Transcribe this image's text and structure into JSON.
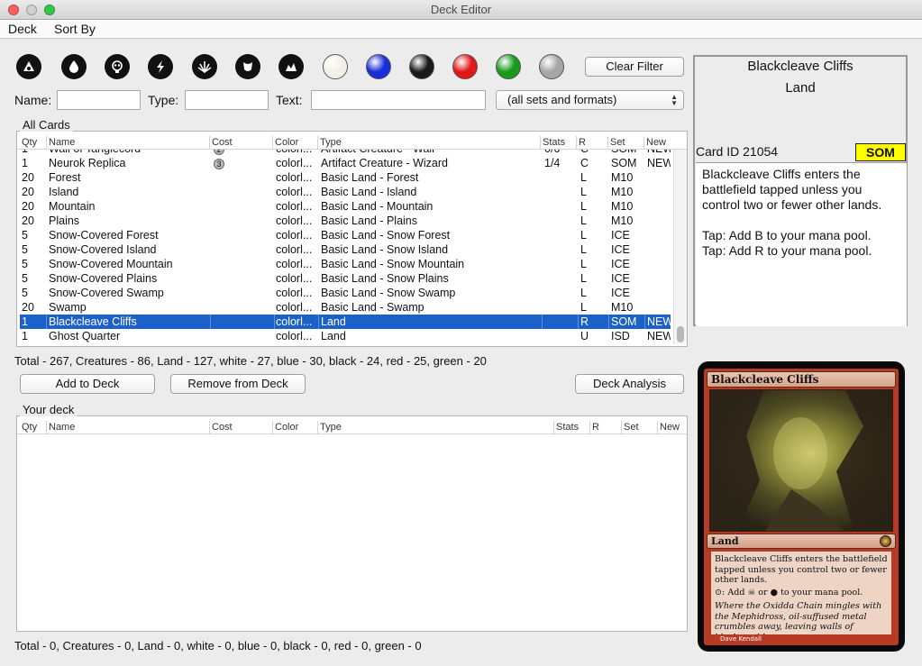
{
  "window": {
    "title": "Deck Editor"
  },
  "menu": {
    "deck": "Deck",
    "sort_by": "Sort By"
  },
  "filters": {
    "mana_symbols": [
      "artifact-icon",
      "blue-mana-icon",
      "black-mana-icon",
      "red-mana-icon",
      "white-mana-icon",
      "green-mana-icon",
      "land-icon"
    ],
    "color_orbs": [
      {
        "name": "white",
        "color": "#f2f0e4"
      },
      {
        "name": "blue",
        "color": "#1a2ed8"
      },
      {
        "name": "black",
        "color": "#1a1a1a"
      },
      {
        "name": "red",
        "color": "#e01818"
      },
      {
        "name": "green",
        "color": "#1a9a1a"
      },
      {
        "name": "colorless",
        "color": "#a6a6a6"
      }
    ],
    "clear_filter": "Clear Filter",
    "name_label": "Name:",
    "name_value": "",
    "type_label": "Type:",
    "type_value": "",
    "text_label": "Text:",
    "text_value": "",
    "set_select": "(all sets and formats)"
  },
  "all_cards": {
    "title": "All Cards",
    "columns": [
      "Qty",
      "Name",
      "Cost",
      "Color",
      "Type",
      "Stats",
      "R",
      "Set",
      "New"
    ],
    "rows": [
      {
        "qty": "1",
        "name": "Wall of Tanglecord",
        "cost": "2",
        "color": "colorl...",
        "type": "Artifact Creature - Wall",
        "stats": "0/6",
        "r": "C",
        "set": "SOM",
        "new": "NEW"
      },
      {
        "qty": "1",
        "name": "Neurok Replica",
        "cost": "3",
        "color": "colorl...",
        "type": "Artifact Creature - Wizard",
        "stats": "1/4",
        "r": "C",
        "set": "SOM",
        "new": "NEW"
      },
      {
        "qty": "20",
        "name": "Forest",
        "cost": "",
        "color": "colorl...",
        "type": "Basic Land - Forest",
        "stats": "",
        "r": "L",
        "set": "M10",
        "new": ""
      },
      {
        "qty": "20",
        "name": "Island",
        "cost": "",
        "color": "colorl...",
        "type": "Basic Land - Island",
        "stats": "",
        "r": "L",
        "set": "M10",
        "new": ""
      },
      {
        "qty": "20",
        "name": "Mountain",
        "cost": "",
        "color": "colorl...",
        "type": "Basic Land - Mountain",
        "stats": "",
        "r": "L",
        "set": "M10",
        "new": ""
      },
      {
        "qty": "20",
        "name": "Plains",
        "cost": "",
        "color": "colorl...",
        "type": "Basic Land - Plains",
        "stats": "",
        "r": "L",
        "set": "M10",
        "new": ""
      },
      {
        "qty": "5",
        "name": "Snow-Covered Forest",
        "cost": "",
        "color": "colorl...",
        "type": "Basic Land - Snow Forest",
        "stats": "",
        "r": "L",
        "set": "ICE",
        "new": ""
      },
      {
        "qty": "5",
        "name": "Snow-Covered Island",
        "cost": "",
        "color": "colorl...",
        "type": "Basic Land - Snow Island",
        "stats": "",
        "r": "L",
        "set": "ICE",
        "new": ""
      },
      {
        "qty": "5",
        "name": "Snow-Covered Mountain",
        "cost": "",
        "color": "colorl...",
        "type": "Basic Land - Snow Mountain",
        "stats": "",
        "r": "L",
        "set": "ICE",
        "new": ""
      },
      {
        "qty": "5",
        "name": "Snow-Covered Plains",
        "cost": "",
        "color": "colorl...",
        "type": "Basic Land - Snow Plains",
        "stats": "",
        "r": "L",
        "set": "ICE",
        "new": ""
      },
      {
        "qty": "5",
        "name": "Snow-Covered Swamp",
        "cost": "",
        "color": "colorl...",
        "type": "Basic Land - Snow Swamp",
        "stats": "",
        "r": "L",
        "set": "ICE",
        "new": ""
      },
      {
        "qty": "20",
        "name": "Swamp",
        "cost": "",
        "color": "colorl...",
        "type": "Basic Land - Swamp",
        "stats": "",
        "r": "L",
        "set": "M10",
        "new": ""
      },
      {
        "qty": "1",
        "name": "Blackcleave Cliffs",
        "cost": "",
        "color": "colorl...",
        "type": "Land",
        "stats": "",
        "r": "R",
        "set": "SOM",
        "new": "NEW",
        "selected": true
      },
      {
        "qty": "1",
        "name": "Ghost Quarter",
        "cost": "",
        "color": "colorl...",
        "type": "Land",
        "stats": "",
        "r": "U",
        "set": "ISD",
        "new": "NEW"
      }
    ],
    "summary": "Total - 267, Creatures - 86, Land - 127, white - 27, blue - 30, black - 24, red - 25, green - 20"
  },
  "actions": {
    "add": "Add to Deck",
    "remove": "Remove from Deck",
    "analysis": "Deck Analysis"
  },
  "your_deck": {
    "title": "Your deck",
    "columns": [
      "Qty",
      "Name",
      "Cost",
      "Color",
      "Type",
      "Stats",
      "R",
      "Set",
      "New"
    ],
    "summary": "Total - 0, Creatures - 0, Land - 0, white - 0, blue - 0, black - 0, red - 0, green - 0"
  },
  "card_detail": {
    "name": "Blackcleave Cliffs",
    "type": "Land",
    "id_label": "Card ID",
    "id": "21054",
    "set": "SOM",
    "set_color": "#ffff00",
    "text": "Blackcleave Cliffs enters the battlefield tapped unless you control two or fewer other lands.\n\nTap: Add B to your mana pool.\nTap: Add R to your mana pool."
  },
  "card_image": {
    "name": "Blackcleave Cliffs",
    "type": "Land",
    "rules": "Blackcleave Cliffs enters the battlefield tapped unless you control two or fewer other lands.",
    "ability": "⊙: Add ☠ or ● to your mana pool.",
    "flavor": "Where the Oxidda Chain mingles with the Mephidross, oil-suffused metal crumbles away, leaving walls of blackened bones.",
    "artist": "Dave Kendall"
  }
}
